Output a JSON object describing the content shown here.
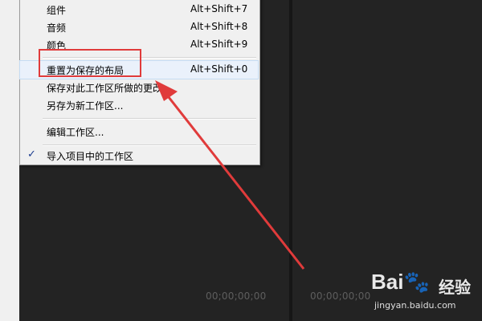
{
  "menu": {
    "items": [
      {
        "label": "组件",
        "shortcut": "Alt+Shift+7"
      },
      {
        "label": "音频",
        "shortcut": "Alt+Shift+8"
      },
      {
        "label": "颜色",
        "shortcut": "Alt+Shift+9"
      },
      {
        "label": "重置为保存的布局",
        "shortcut": "Alt+Shift+0"
      },
      {
        "label": "保存对此工作区所做的更改",
        "shortcut": ""
      },
      {
        "label": "另存为新工作区...",
        "shortcut": ""
      },
      {
        "label": "编辑工作区...",
        "shortcut": ""
      },
      {
        "label": "导入项目中的工作区",
        "shortcut": "",
        "checked": true
      }
    ]
  },
  "monitor": {
    "left_timecode": "00;00;00;00",
    "right_timecode": "00;00;00;00"
  },
  "annotation": {
    "highlight_color": "#e03b3b"
  },
  "watermark": {
    "logo": "Bai🐾",
    "brand": "经验",
    "url": "jingyan.baidu.com"
  }
}
